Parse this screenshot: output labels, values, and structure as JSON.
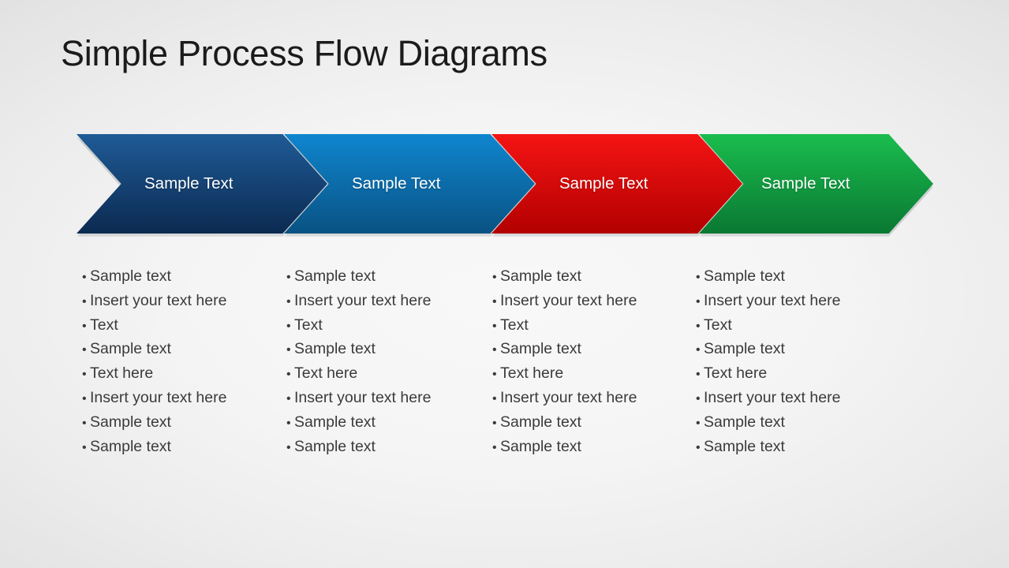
{
  "slide": {
    "title": "Simple Process Flow Diagrams",
    "background_center_color": "#f7f7f7",
    "background_edge_color": "#e2e2e2"
  },
  "steps": [
    {
      "label": "Sample Text",
      "color_name": "navy-blue",
      "gradient_top": "#1f5b96",
      "gradient_bottom": "#0b2a51",
      "bullets": [
        "Sample text",
        "Insert your text here",
        "Text",
        "Sample text",
        "Text  here",
        "Insert your text here",
        "Sample text",
        "Sample text"
      ]
    },
    {
      "label": "Sample Text",
      "color_name": "bright-blue",
      "gradient_top": "#0f86cf",
      "gradient_bottom": "#095283",
      "bullets": [
        "Sample text",
        "Insert your text here",
        "Text",
        "Sample text",
        "Text  here",
        "Insert your text here",
        "Sample text",
        "Sample text"
      ]
    },
    {
      "label": "Sample Text",
      "color_name": "red",
      "gradient_top": "#f51414",
      "gradient_bottom": "#b30000",
      "bullets": [
        "Sample text",
        "Insert your text here",
        "Text",
        "Sample text",
        "Text  here",
        "Insert your text here",
        "Sample text",
        "Sample text"
      ]
    },
    {
      "label": "Sample Text",
      "color_name": "green",
      "gradient_top": "#1abd4e",
      "gradient_bottom": "#0a7832",
      "bullets": [
        "Sample text",
        "Insert your text here",
        "Text",
        "Sample text",
        "Text  here",
        "Insert your text here",
        "Sample text",
        "Sample text"
      ]
    }
  ],
  "bullet_glyph": "•"
}
